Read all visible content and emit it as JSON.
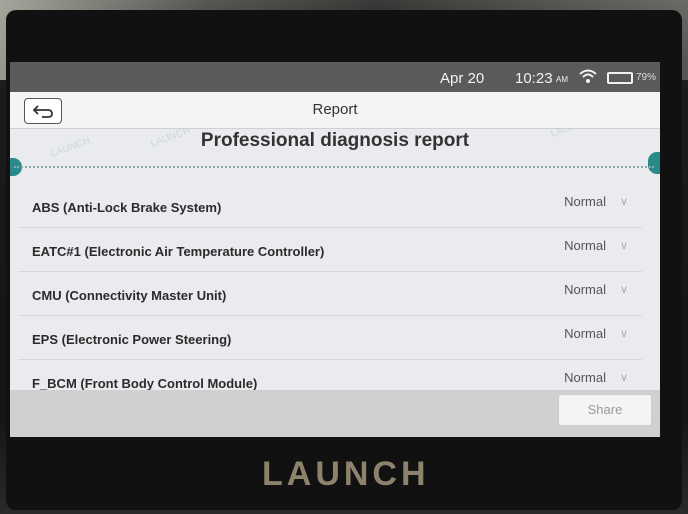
{
  "status_bar": {
    "date": "Apr 20",
    "time": "10:23",
    "ampm": "AM",
    "battery": "79%"
  },
  "header": {
    "title": "Report"
  },
  "report": {
    "heading": "Professional diagnosis report",
    "rows": [
      {
        "label": "ABS (Anti-Lock Brake System)",
        "status": "Normal"
      },
      {
        "label": "EATC#1 (Electronic Air Temperature Controller)",
        "status": "Normal"
      },
      {
        "label": "CMU (Connectivity Master Unit)",
        "status": "Normal"
      },
      {
        "label": "EPS (Electronic Power Steering)",
        "status": "Normal"
      },
      {
        "label": "F_BCM (Front Body Control Module)",
        "status": "Normal"
      }
    ]
  },
  "footer": {
    "share_label": "Share"
  },
  "brand": "LAUNCH",
  "colors": {
    "accent": "#2a8a8a",
    "screen_bg": "#e9ebee"
  }
}
